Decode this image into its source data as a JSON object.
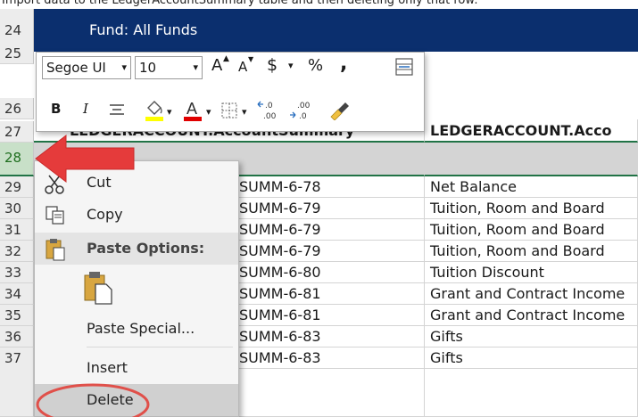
{
  "caption": "Import data to the LedgerAccountSummary table and then deleting only that row:",
  "banner": {
    "text": "Fund: All Funds",
    "color": "#0b2f6e"
  },
  "header_row": {
    "col_e": "LEDGERACCOUNT.AccountSummary",
    "col_f": "LEDGERACCOUNT.Acco"
  },
  "row_numbers": [
    "24",
    "25",
    "26",
    "27",
    "28",
    "29",
    "30",
    "31",
    "32",
    "33",
    "34",
    "35",
    "36",
    "37"
  ],
  "rows": [
    {
      "code": "SUMM-6-78",
      "desc": "Net Balance"
    },
    {
      "code": "SUMM-6-79",
      "desc": "Tuition, Room and Board"
    },
    {
      "code": "SUMM-6-79",
      "desc": "Tuition, Room and Board"
    },
    {
      "code": "SUMM-6-79",
      "desc": "Tuition, Room and Board"
    },
    {
      "code": "SUMM-6-80",
      "desc": "Tuition Discount"
    },
    {
      "code": "SUMM-6-81",
      "desc": "Grant and Contract Income"
    },
    {
      "code": "SUMM-6-81",
      "desc": "Grant and Contract Income"
    },
    {
      "code": "SUMM-6-83",
      "desc": "Gifts"
    },
    {
      "code": "SUMM-6-83",
      "desc": "Gifts"
    }
  ],
  "mini_toolbar": {
    "font_name": "Segoe UI",
    "font_size": "10",
    "grow_font": "A",
    "shrink_font": "A",
    "currency": "$",
    "percent": "%",
    "comma": ",",
    "bold": "B",
    "italic": "I",
    "increase_decimal": ".0 .00",
    "decrease_decimal": ".00 .0"
  },
  "context_menu": {
    "cut": "Cut",
    "copy": "Copy",
    "paste_options": "Paste Options:",
    "paste_special": "Paste Special...",
    "insert": "Insert",
    "delete": "Delete"
  },
  "colors": {
    "accent_red": "#e53b3b",
    "selection_green": "#217346",
    "highlight_yellow": "#ffff00",
    "font_red": "#e00000"
  }
}
